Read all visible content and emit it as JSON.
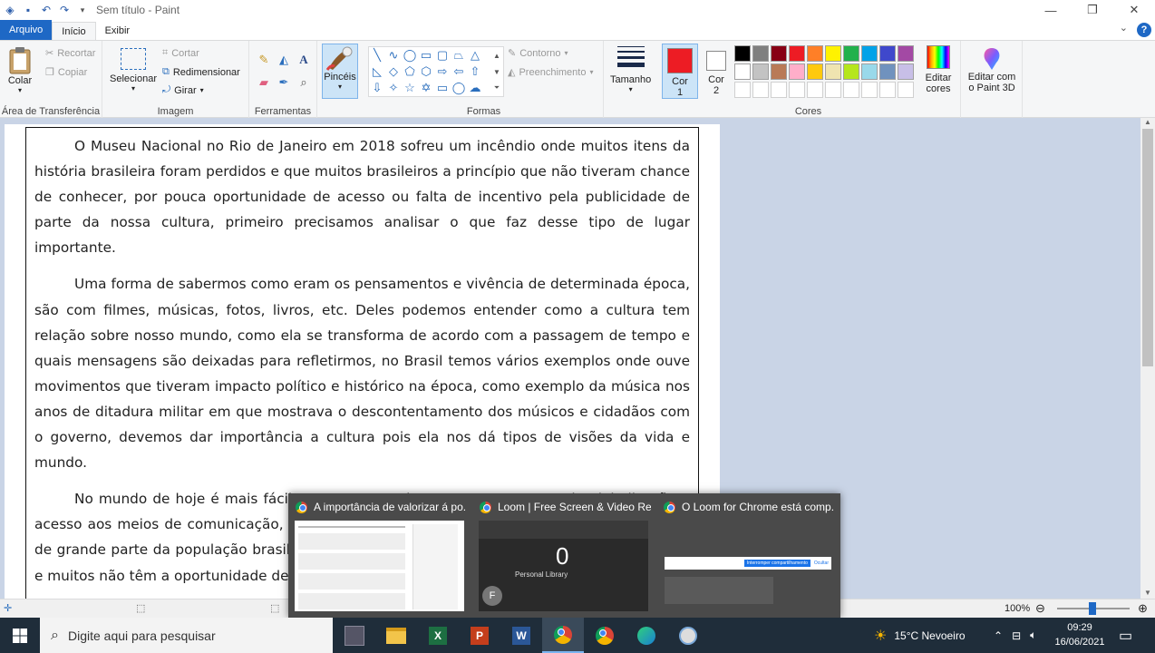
{
  "window": {
    "title": "Sem título - Paint",
    "minimize": "—",
    "maximize": "❐",
    "close": "✕"
  },
  "tabs": {
    "file": "Arquivo",
    "home": "Início",
    "view": "Exibir"
  },
  "ribbon": {
    "clipboard": {
      "paste": "Colar",
      "cut": "Recortar",
      "copy": "Copiar",
      "label": "Área de Transferência"
    },
    "image": {
      "select": "Selecionar",
      "crop": "Cortar",
      "resize": "Redimensionar",
      "rotate": "Girar",
      "label": "Imagem"
    },
    "tools": {
      "label": "Ferramentas"
    },
    "brushes": {
      "label": "Pincéis"
    },
    "shapes": {
      "outline": "Contorno",
      "fill": "Preenchimento",
      "label": "Formas"
    },
    "size": {
      "label": "Tamanho"
    },
    "colors": {
      "color1_line1": "Cor",
      "color1_line2": "1",
      "color2_line1": "Cor",
      "color2_line2": "2",
      "edit_line1": "Editar",
      "edit_line2": "cores",
      "paint3d_line1": "Editar com",
      "paint3d_line2": "o Paint 3D",
      "label": "Cores",
      "color1_value": "#ed1c24",
      "color2_value": "#ffffff",
      "palette_row1": [
        "#000000",
        "#7f7f7f",
        "#880015",
        "#ed1c24",
        "#ff7f27",
        "#fff200",
        "#22b14c",
        "#00a2e8",
        "#3f48cc",
        "#a349a4"
      ],
      "palette_row2": [
        "#ffffff",
        "#c3c3c3",
        "#b97a57",
        "#ffaec9",
        "#ffc90e",
        "#efe4b0",
        "#b5e61d",
        "#99d9ea",
        "#7092be",
        "#c8bfe7"
      ]
    }
  },
  "document": {
    "paragraphs": [
      "O Museu Nacional no Rio de Janeiro em 2018 sofreu um incêndio onde muitos itens da história brasileira foram perdidos e que muitos brasileiros a princípio que não tiveram chance de conhecer, por pouca oportunidade de acesso ou falta de incentivo pela publicidade de parte da nossa cultura, primeiro precisamos analisar o que faz desse tipo de lugar importante.",
      "Uma forma de sabermos como eram os pensamentos e vivência de determinada época, são com filmes, músicas, fotos, livros, etc. Deles podemos entender como a cultura tem relação sobre nosso mundo, como ela se transforma de acordo com a passagem de tempo e quais mensagens são deixadas para refletirmos, no Brasil temos vários exemplos onde ouve movimentos que tiveram impacto político e histórico na época, como exemplo da música nos anos de ditadura militar em que mostrava o descontentamento dos músicos e cidadãos com o governo, devemos dar importância a cultura pois ela nos dá tipos de visões da vida e mundo.",
      "No mundo de hoje é mais fácil ter acesso a cultura com o crescente de globalização e acesso aos meios de comunicação, porém ainda há muita desigualdade e pouca visibilidade de grande parte da população brasileira, pois a realidade financeira da maioria é complicada e muitos não têm a oportunidade de conhecer, a classe baixa no Brasil"
    ]
  },
  "statusbar": {
    "zoom": "100%"
  },
  "preview": {
    "items": [
      {
        "title": "A importância de valorizar á po..."
      },
      {
        "title": "Loom | Free Screen & Video Re...",
        "count": "0",
        "sub": "Personal Library",
        "avatar": "F"
      },
      {
        "title": "O Loom for Chrome está comp...",
        "btn": "Interromper compartilhamento",
        "btn2": "Ocultar"
      }
    ]
  },
  "taskbar": {
    "search_placeholder": "Digite aqui para pesquisar",
    "weather": "15°C  Nevoeiro",
    "time": "09:29",
    "date": "16/06/2021"
  }
}
